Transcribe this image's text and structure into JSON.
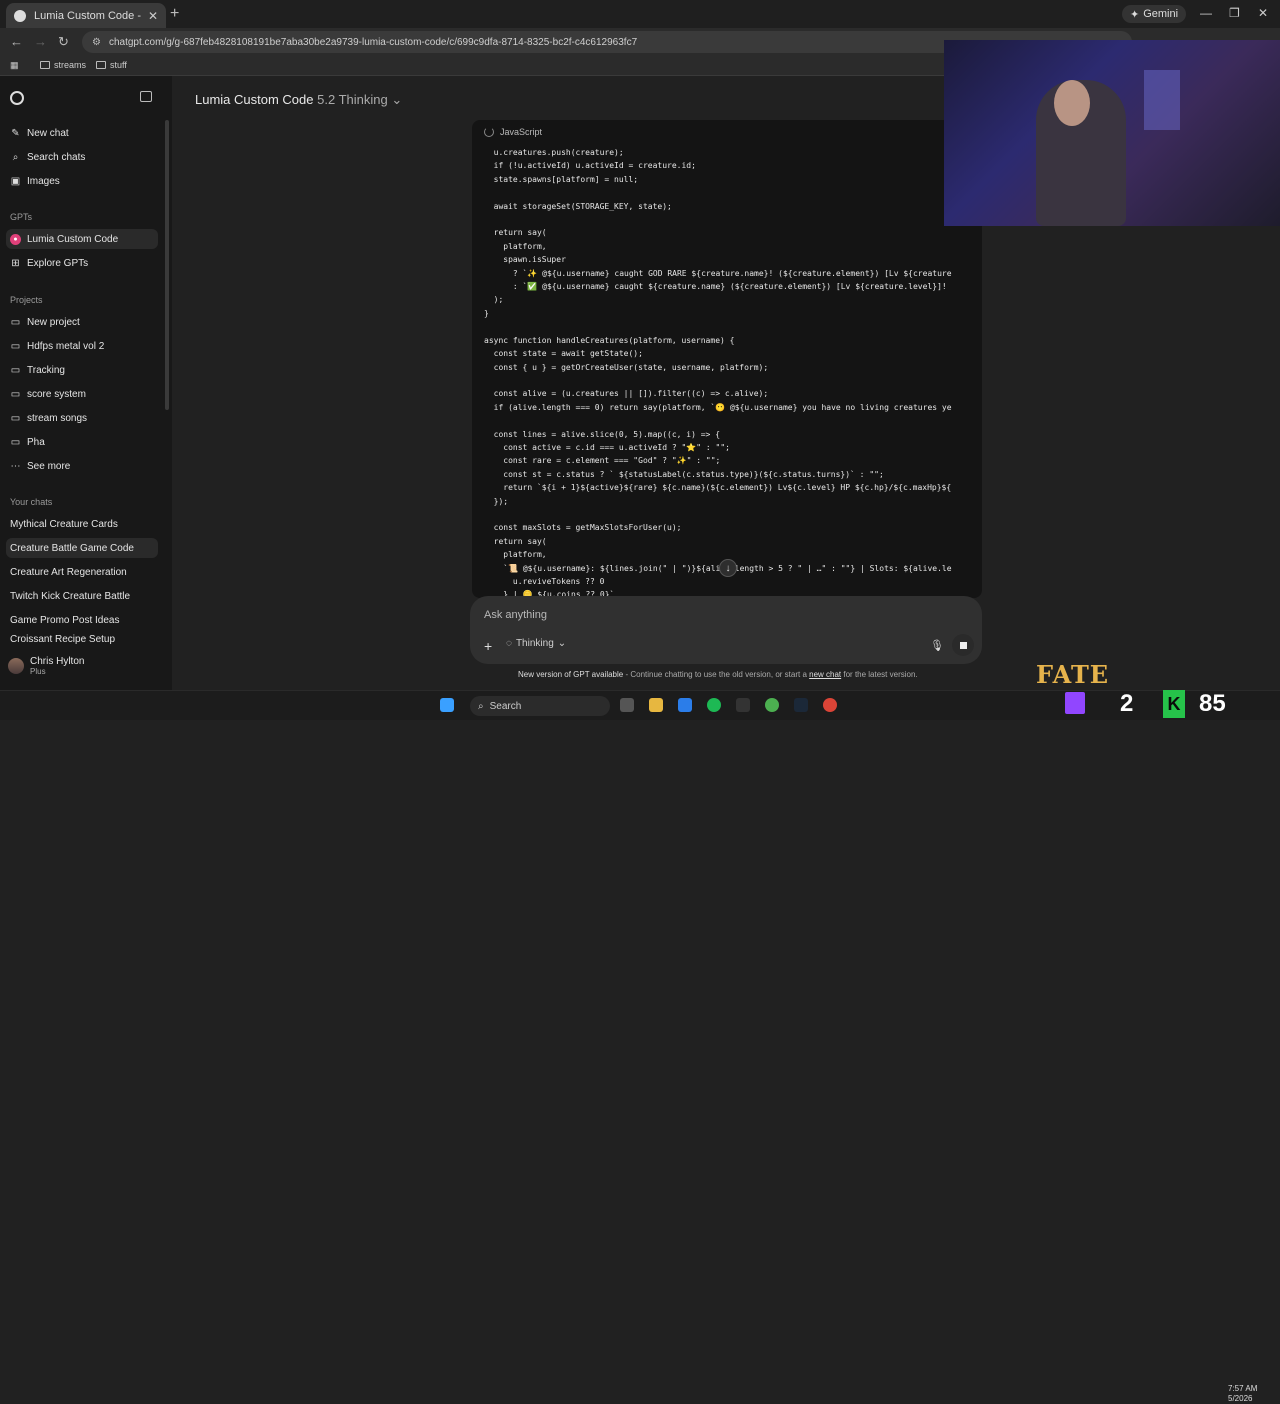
{
  "browser": {
    "tab_title": "Lumia Custom Code - Creature",
    "url": "chatgpt.com/g/g-687feb4828108191be7aba30be2a9739-lumia-custom-code/c/699c9dfa-8714-8325-bc2f-c4c612963fc7",
    "gemini_label": "Gemini",
    "bookmarks": [
      "streams",
      "stuff"
    ]
  },
  "sidebar": {
    "actions": [
      {
        "label": "New chat",
        "icon": "new-chat-icon"
      },
      {
        "label": "Search chats",
        "icon": "search-icon"
      },
      {
        "label": "Images",
        "icon": "image-icon"
      }
    ],
    "gpts_heading": "GPTs",
    "gpts": [
      {
        "label": "Lumia Custom Code",
        "icon": "gpt-avatar-icon"
      },
      {
        "label": "Explore GPTs",
        "icon": "explore-icon"
      }
    ],
    "projects_heading": "Projects",
    "projects": [
      {
        "label": "New project",
        "icon": "folder-plus-icon"
      },
      {
        "label": "Hdfps metal vol 2",
        "icon": "folder-icon"
      },
      {
        "label": "Tracking",
        "icon": "folder-icon"
      },
      {
        "label": "score system",
        "icon": "folder-icon"
      },
      {
        "label": "stream songs",
        "icon": "folder-icon"
      },
      {
        "label": "Pha",
        "icon": "folder-icon"
      },
      {
        "label": "See more",
        "icon": "more-icon"
      }
    ],
    "chats_heading": "Your chats",
    "chats": [
      "Mythical Creature Cards",
      "Creature Battle Game Code",
      "Creature Art Regeneration",
      "Twitch Kick Creature Battle",
      "Game Promo Post Ideas",
      "Croissant Recipe Setup"
    ],
    "user": {
      "name": "Chris Hylton",
      "plan": "Plus"
    }
  },
  "header": {
    "title": "Lumia Custom Code",
    "model": "5.2 Thinking"
  },
  "code_block": {
    "language": "JavaScript",
    "lines": [
      "  u.creatures.push(creature);",
      "  if (!u.activeId) u.activeId = creature.id;",
      "  state.spawns[platform] = null;",
      "",
      "  await storageSet(STORAGE_KEY, state);",
      "",
      "  return say(",
      "    platform,",
      "    spawn.isSuper",
      "      ? `✨ @${u.username} caught GOD RARE ${creature.name}! (${creature.element}) [Lv ${creature",
      "      : `✅ @${u.username} caught ${creature.name} (${creature.element}) [Lv ${creature.level}]!",
      "  );",
      "}",
      "",
      "async function handleCreatures(platform, username) {",
      "  const state = await getState();",
      "  const { u } = getOrCreateUser(state, username, platform);",
      "",
      "  const alive = (u.creatures || []).filter((c) => c.alive);",
      "  if (alive.length === 0) return say(platform, `😶 @${u.username} you have no living creatures ye",
      "",
      "  const lines = alive.slice(0, 5).map((c, i) => {",
      "    const active = c.id === u.activeId ? \"⭐\" : \"\";",
      "    const rare = c.element === \"God\" ? \"✨\" : \"\";",
      "    const st = c.status ? ` ${statusLabel(c.status.type)}(${c.status.turns})` : \"\";",
      "    return `${i + 1}${active}${rare} ${c.name}(${c.element}) Lv${c.level} HP ${c.hp}/${c.maxHp}${",
      "  });",
      "",
      "  const maxSlots = getMaxSlotsForUser(u);",
      "  return say(",
      "    platform,",
      "    `📜 @${u.username}: ${lines.join(\" | \")}${alive.length > 5 ? \" | …\" : \"\"} | Slots: ${alive.le",
      "      u.reviveTokens ?? 0",
      "    } | 🪙 ${u.coins ?? 0}`"
    ]
  },
  "composer": {
    "placeholder": "Ask anything",
    "mode": "Thinking"
  },
  "notice": {
    "bold": "New version of GPT available",
    "text": " - Continue chatting to use the old version, or start a ",
    "link": "new chat",
    "tail": " for the latest version."
  },
  "taskbar": {
    "search_label": "Search",
    "clock_time": "7:57 AM",
    "clock_date": "5/2026"
  },
  "overlay": {
    "logo_text": "FATE",
    "counter_left": "2",
    "counter_right": "85"
  }
}
